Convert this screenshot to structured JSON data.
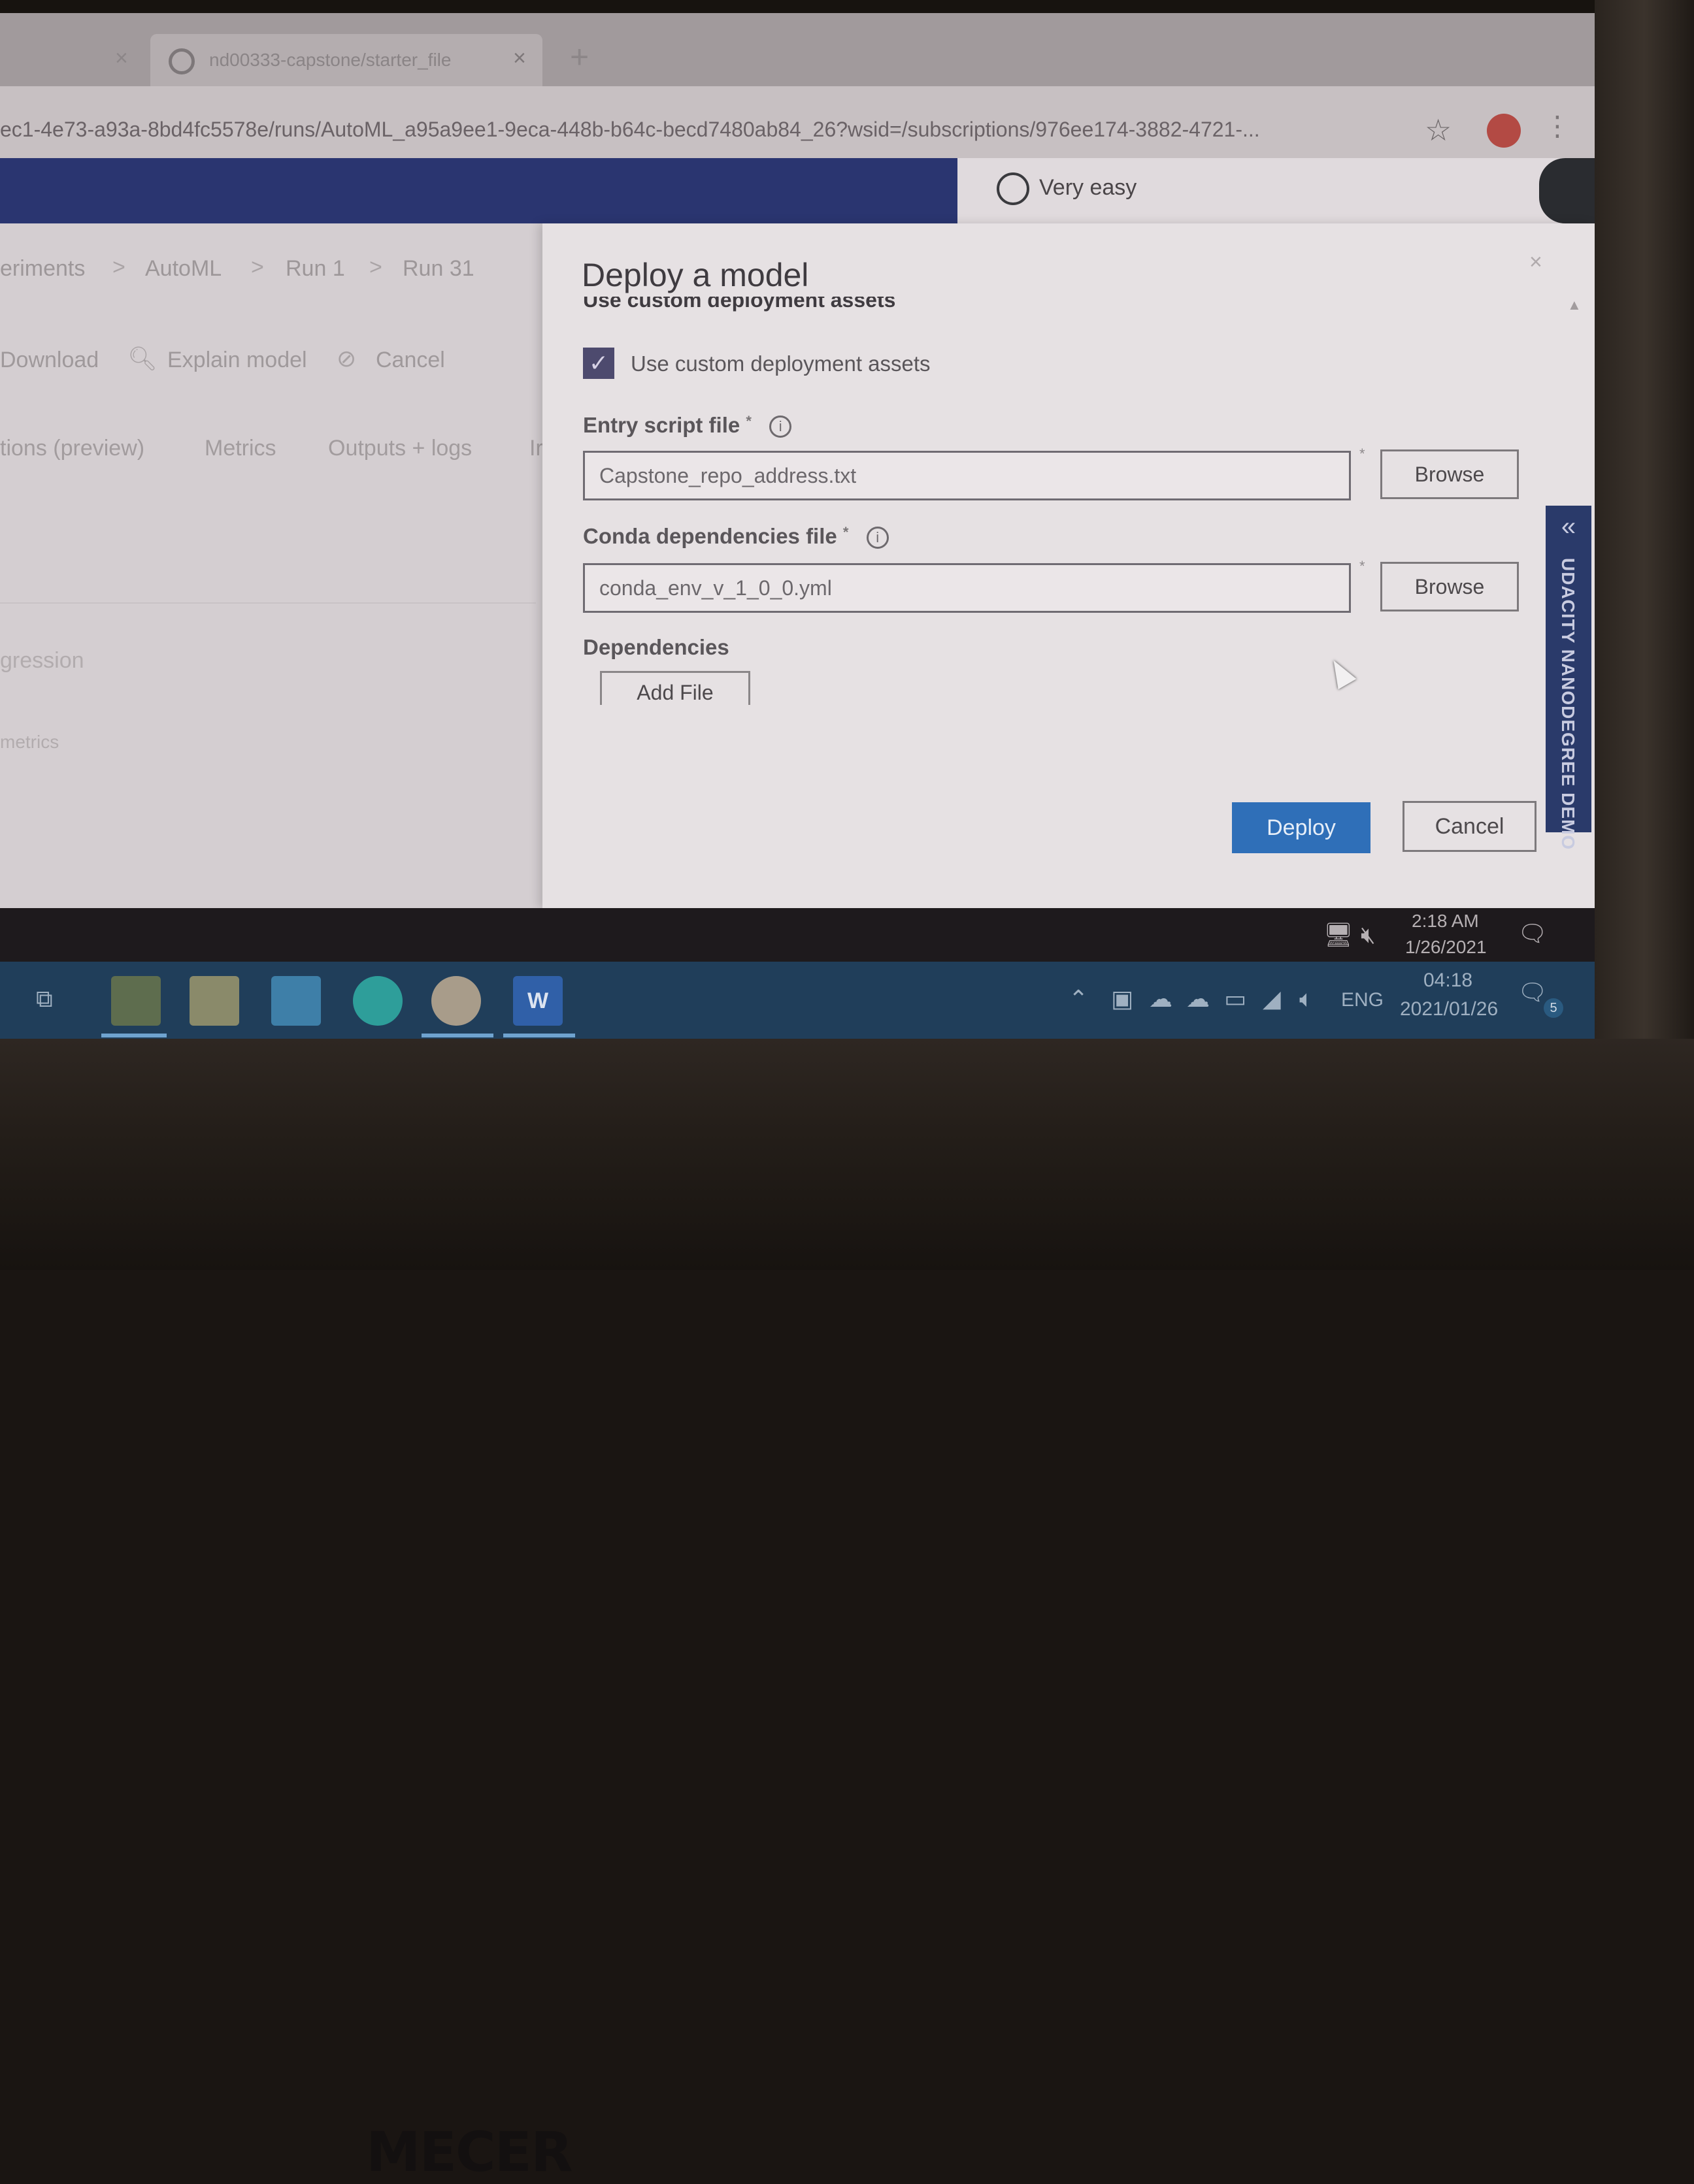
{
  "browser": {
    "active_tab_title": "nd00333-capstone/starter_file",
    "url": "ec1-4e73-a93a-8bd4fc5578e/runs/AutoML_a95a9ee1-9eca-448b-b64c-becd7480ab84_26?wsid=/subscriptions/976ee174-3882-4721-...",
    "tab_close_glyph": "×",
    "new_tab_glyph": "+",
    "star_glyph": "☆",
    "menu_glyph": "⋮"
  },
  "survey": {
    "option_label": "Very easy"
  },
  "background_page": {
    "breadcrumbs": [
      "eriments",
      "AutoML",
      "Run 1",
      "Run 31"
    ],
    "breadcrumb_separator": ">",
    "commands": [
      "Download",
      "Explain model",
      "Cancel"
    ],
    "subtabs": [
      "tions (preview)",
      "Metrics",
      "Outputs + logs",
      "Ir"
    ],
    "faint_items": [
      "gression",
      "metrics"
    ]
  },
  "panel": {
    "title": "Deploy a model",
    "close_glyph": "×",
    "section_heading": "Use custom deployment assets",
    "checkbox_label": "Use custom deployment assets",
    "checkbox_checked": true,
    "check_glyph": "✓",
    "entry_script": {
      "label": "Entry script file",
      "value": "Capstone_repo_address.txt",
      "browse_label": "Browse"
    },
    "conda_deps": {
      "label": "Conda dependencies file",
      "value": "conda_env_v_1_0_0.yml",
      "browse_label": "Browse"
    },
    "required_marker": "*",
    "info_glyph": "i",
    "dependencies_label": "Dependencies",
    "add_file_label": "Add File",
    "deploy_label": "Deploy",
    "cancel_label": "Cancel"
  },
  "udacity": {
    "label": "UDACITY NANODEGREE DEMO",
    "chevron": "«"
  },
  "remote_tray": {
    "time": "2:18 AM",
    "date": "1/26/2021"
  },
  "taskbar": {
    "language": "ENG",
    "time": "04:18",
    "date": "2021/01/26",
    "notification_count": "5",
    "word_letter": "W"
  },
  "colors": {
    "accent_blue": "#2f6fb8",
    "topbar_navy": "#2a3570",
    "taskbar_blue": "#203e5a"
  }
}
